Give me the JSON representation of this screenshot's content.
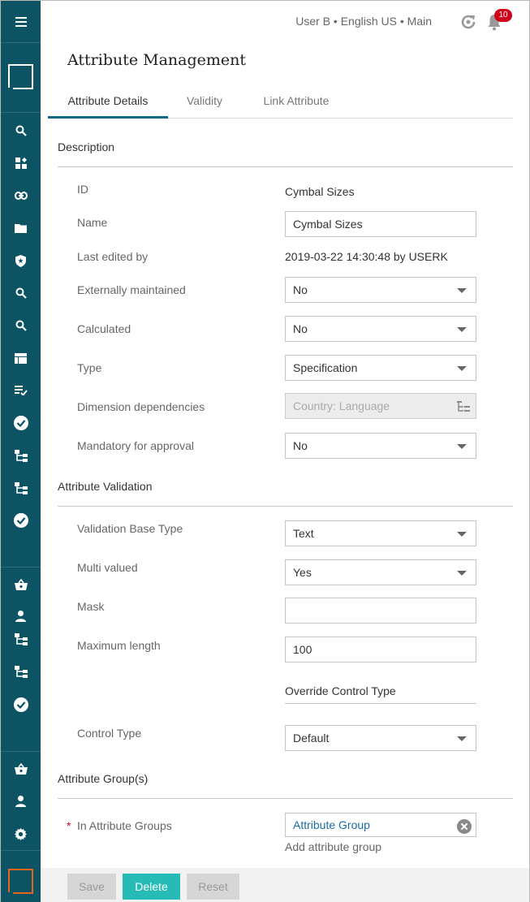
{
  "header": {
    "user_info": "User B • English US • Main",
    "notification_count": "10"
  },
  "page": {
    "title": "Attribute Management"
  },
  "tabs": [
    {
      "label": "Attribute Details",
      "active": true
    },
    {
      "label": "Validity",
      "active": false
    },
    {
      "label": "Link Attribute",
      "active": false
    }
  ],
  "description": {
    "section_title": "Description",
    "id_label": "ID",
    "id_value": "Cymbal Sizes",
    "name_label": "Name",
    "name_value": "Cymbal Sizes",
    "last_edited_label": "Last edited by",
    "last_edited_value": "2019-03-22 14:30:48 by USERK",
    "externally_maintained_label": "Externally maintained",
    "externally_maintained_value": "No",
    "calculated_label": "Calculated",
    "calculated_value": "No",
    "type_label": "Type",
    "type_value": "Specification",
    "dimension_label": "Dimension dependencies",
    "dimension_placeholder": "Country: Language",
    "mandatory_label": "Mandatory for approval",
    "mandatory_value": "No"
  },
  "validation": {
    "section_title": "Attribute Validation",
    "base_type_label": "Validation Base Type",
    "base_type_value": "Text",
    "multi_valued_label": "Multi valued",
    "multi_valued_value": "Yes",
    "mask_label": "Mask",
    "mask_value": "",
    "max_length_label": "Maximum length",
    "max_length_value": "100",
    "override_title": "Override Control Type",
    "control_type_label": "Control Type",
    "control_type_value": "Default"
  },
  "groups": {
    "section_title": "Attribute Group(s)",
    "required_mark": "*",
    "in_groups_label": "In Attribute Groups",
    "group_value": "Attribute Group",
    "add_group_link": "Add attribute group"
  },
  "footer": {
    "save_label": "Save",
    "delete_label": "Delete",
    "reset_label": "Reset"
  },
  "colors": {
    "sidebar": "#0c5364",
    "accent": "#26bcb5",
    "badge": "#d0021b",
    "brand_orange": "#e8641c",
    "link": "#1c6ea4"
  }
}
